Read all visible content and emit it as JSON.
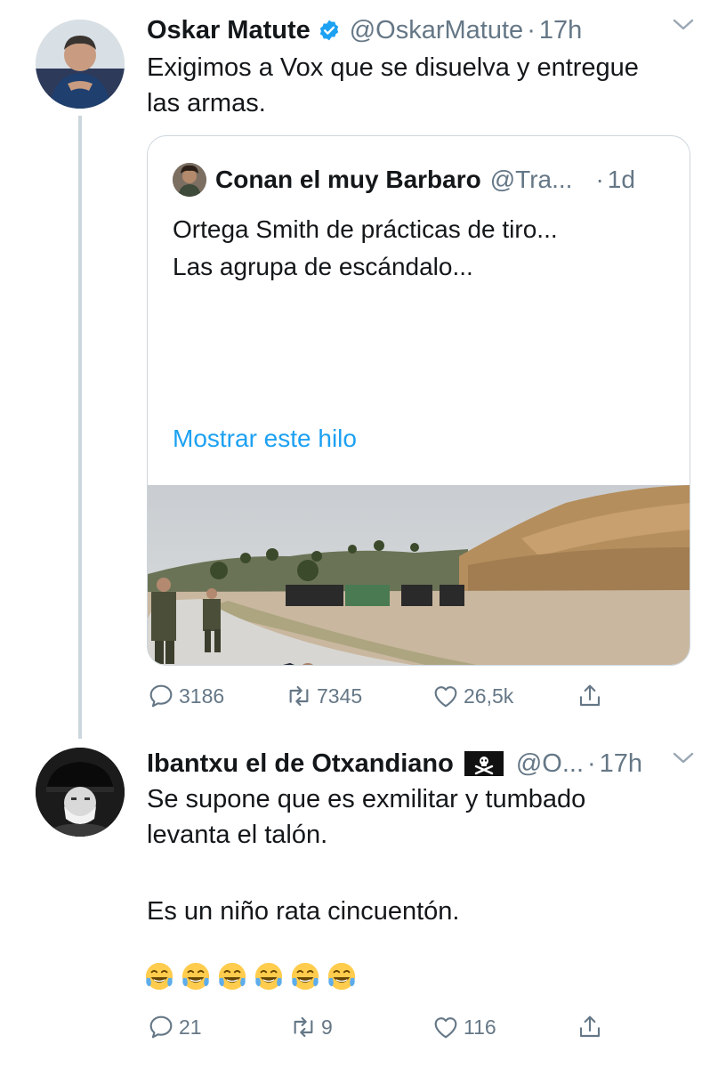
{
  "tweet1": {
    "name": "Oskar Matute",
    "handle": "@OskarMatute",
    "dot": "·",
    "time": "17h",
    "text_line1": "Exigimos a Vox que se disuelva y entregue",
    "text_line2": "las armas.",
    "quote": {
      "name": "Conan el muy Barbaro",
      "handle": "@Tra...",
      "dot": "·",
      "time": "1d",
      "text_line1": "Ortega Smith de prácticas de tiro...",
      "text_line2": "Las agrupa de escándalo...",
      "show_thread": "Mostrar este hilo"
    },
    "actions": {
      "replies": "3186",
      "retweets": "7345",
      "likes": "26,5k"
    }
  },
  "tweet2": {
    "name": "Ibantxu el de Otxandiano",
    "handle": "@O...",
    "dot": "·",
    "time": "17h",
    "text_line1": "Se supone que es exmilitar y tumbado",
    "text_line2": "levanta el talón.",
    "text_line3": "Es un niño rata cincuentón.",
    "emoji_count": 6,
    "actions": {
      "replies": "21",
      "retweets": "9",
      "likes": "116"
    }
  },
  "colors": {
    "text": "#14171a",
    "secondary": "#657786",
    "link": "#1da1f2",
    "border": "#ccd6dd",
    "verified": "#1da1f2"
  },
  "icons": [
    "verified-icon",
    "chevron-down-icon",
    "reply-icon",
    "retweet-icon",
    "like-icon",
    "share-icon",
    "pirate-flag-icon",
    "joy-emoji"
  ]
}
